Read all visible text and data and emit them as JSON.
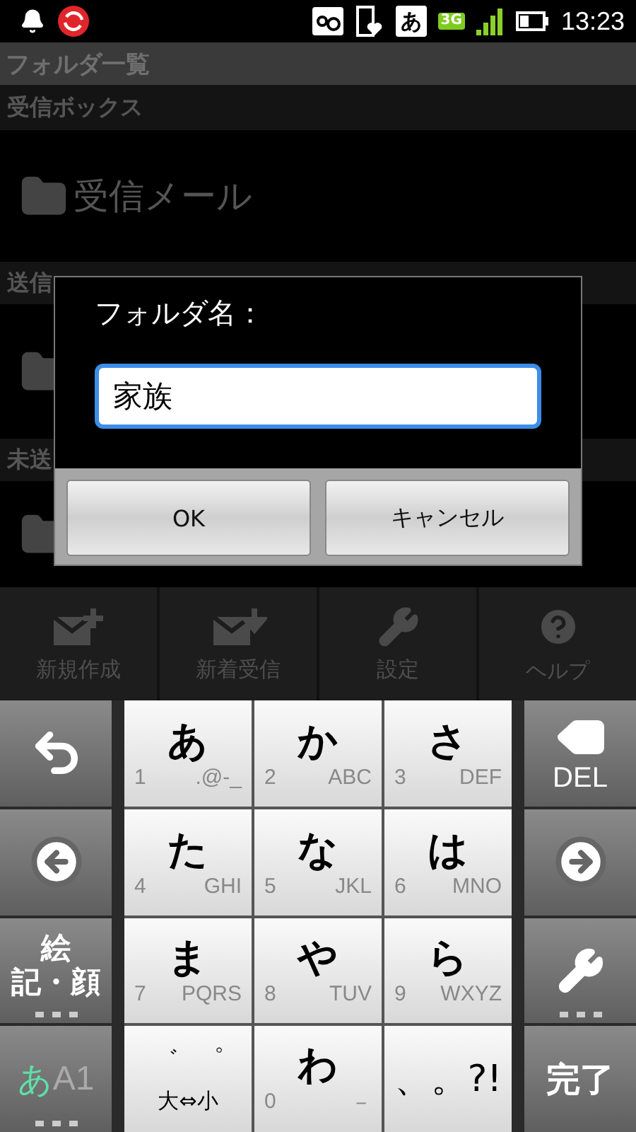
{
  "status_bar": {
    "ime": "あ",
    "network": "3G",
    "time": "13:23"
  },
  "title": "フォルダ一覧",
  "sections": [
    {
      "header": "受信ボックス",
      "folder": "受信メール"
    },
    {
      "header": "送信"
    },
    {
      "header": "未送"
    }
  ],
  "dialog": {
    "title": "フォルダ名：",
    "value": "家族",
    "buttons": [
      "OK",
      "キャンセル"
    ]
  },
  "toolbar": [
    {
      "kind": "compose",
      "label": "新規作成"
    },
    {
      "kind": "receive",
      "label": "新着受信"
    },
    {
      "kind": "settings",
      "label": "設定"
    },
    {
      "kind": "help",
      "label": "ヘルプ"
    }
  ],
  "keyboard": {
    "left": [
      {
        "kind": "undo"
      },
      {
        "kind": "left"
      },
      {
        "kind": "emoji",
        "lines": [
          "絵",
          "記・顔"
        ]
      },
      {
        "kind": "mode",
        "label_a": "あ",
        "label_b": "A1"
      }
    ],
    "keys": [
      {
        "kind": "kana",
        "kana": "あ",
        "num": "1",
        "alpha": ".@-_"
      },
      {
        "kind": "kana",
        "kana": "か",
        "num": "2",
        "alpha": "ABC"
      },
      {
        "kind": "kana",
        "kana": "さ",
        "num": "3",
        "alpha": "DEF"
      },
      {
        "kind": "kana",
        "kana": "た",
        "num": "4",
        "alpha": "GHI"
      },
      {
        "kind": "kana",
        "kana": "な",
        "num": "5",
        "alpha": "JKL"
      },
      {
        "kind": "kana",
        "kana": "は",
        "num": "6",
        "alpha": "MNO"
      },
      {
        "kind": "kana",
        "kana": "ま",
        "num": "7",
        "alpha": "PQRS"
      },
      {
        "kind": "kana",
        "kana": "や",
        "num": "8",
        "alpha": "TUV"
      },
      {
        "kind": "kana",
        "kana": "ら",
        "num": "9",
        "alpha": "WXYZ"
      },
      {
        "kind": "modifier",
        "marks": [
          "゛",
          "゜"
        ],
        "label": "大⇔小"
      },
      {
        "kind": "kana",
        "kana": "わ",
        "num": "0",
        "alpha": "－"
      },
      {
        "kind": "punct",
        "label": "、。?!"
      }
    ],
    "right": [
      {
        "kind": "delete",
        "label": "DEL"
      },
      {
        "kind": "right"
      },
      {
        "kind": "tools"
      },
      {
        "kind": "done",
        "label": "完了"
      }
    ]
  }
}
